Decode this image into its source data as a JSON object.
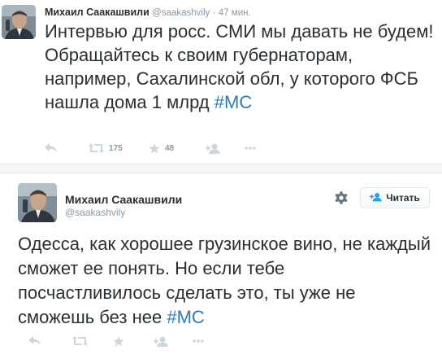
{
  "tweet1": {
    "author_name": "Михаил Саакашвили",
    "handle": "@saakashvily",
    "separator": "·",
    "time": "47 мин.",
    "text": "Интервью для росс. СМИ мы давать не будем! Обращайтесь к своим губернаторам, например, Сахалинской обл, у которого ФСБ нашла дома 1 млрд ",
    "hashtag": "#МС",
    "retweets": "175",
    "favorites": "48",
    "icons": [
      "reply-icon",
      "retweet-icon",
      "favorite-icon",
      "follow-icon",
      "more-icon"
    ]
  },
  "tweet2": {
    "author_name": "Михаил Саакашвили",
    "handle": "@saakashvily",
    "follow_label": "Читать",
    "text": "Одесса, как хорошее грузинское вино, не каждый сможет ее понять. Но если тебе посчастливилось сделать это, ты уже не сможешь без нее ",
    "hashtag": "#МС",
    "icons": [
      "gear-icon",
      "follow-icon",
      "reply-icon",
      "retweet-icon",
      "favorite-icon",
      "more-icon"
    ]
  },
  "colors": {
    "text": "#292f33",
    "muted": "#8899a6",
    "link": "#2b7bb9",
    "icon": "#ccd6dd",
    "separator": "#f5f8fa"
  }
}
